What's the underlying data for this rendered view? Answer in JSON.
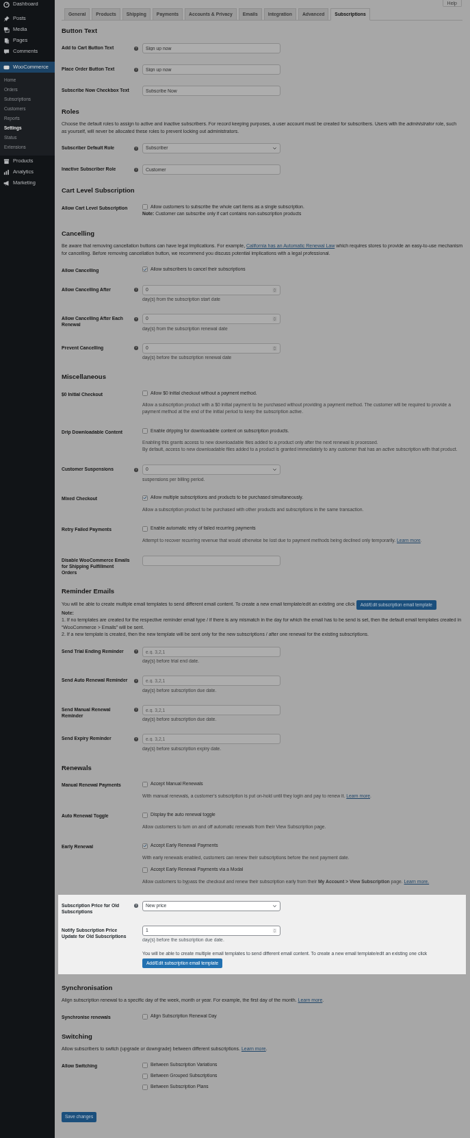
{
  "sidebar": {
    "items": [
      {
        "label": "Dashboard",
        "selected": false
      },
      {
        "label": "Posts",
        "selected": false
      },
      {
        "label": "Media",
        "selected": false
      },
      {
        "label": "Pages",
        "selected": false
      },
      {
        "label": "Comments",
        "selected": false
      },
      {
        "label": "WooCommerce",
        "selected": true,
        "children": [
          {
            "label": "Home",
            "selected": false
          },
          {
            "label": "Orders",
            "selected": false
          },
          {
            "label": "Subscriptions",
            "selected": false
          },
          {
            "label": "Customers",
            "selected": false
          },
          {
            "label": "Reports",
            "selected": false
          },
          {
            "label": "Settings",
            "selected": true
          },
          {
            "label": "Status",
            "selected": false
          },
          {
            "label": "Extensions",
            "selected": false
          }
        ]
      },
      {
        "label": "Products",
        "selected": false
      },
      {
        "label": "Analytics",
        "selected": false
      },
      {
        "label": "Marketing",
        "selected": false
      }
    ]
  },
  "help_button": "Help",
  "tabs": [
    {
      "label": "General",
      "selected": false
    },
    {
      "label": "Products",
      "selected": false
    },
    {
      "label": "Shipping",
      "selected": false
    },
    {
      "label": "Payments",
      "selected": false
    },
    {
      "label": "Accounts & Privacy",
      "selected": false
    },
    {
      "label": "Emails",
      "selected": false
    },
    {
      "label": "Integration",
      "selected": false
    },
    {
      "label": "Advanced",
      "selected": false
    },
    {
      "label": "Subscriptions",
      "selected": true
    }
  ],
  "sections": [
    {
      "title": "Button Text",
      "rows": [
        {
          "label": "Add to Cart Button Text",
          "help": true,
          "controls": [
            {
              "kind": "text",
              "value": "Sign up now"
            }
          ]
        },
        {
          "label": "Place Order Button Text",
          "help": true,
          "controls": [
            {
              "kind": "text",
              "value": "Sign up now"
            }
          ]
        },
        {
          "label": "Subscribe Now Checkbox Text",
          "help": false,
          "controls": [
            {
              "kind": "text",
              "value": "Subscribe Now"
            }
          ]
        }
      ]
    },
    {
      "title": "Roles",
      "description": [
        {
          "parts": [
            {
              "kind": "text",
              "text": "Choose the default roles to assign to active and inactive subscribers. For record keeping purposes, a user account must be created for subscribers. Users with the *administrator* role, such as yourself, will never be allocated these roles to prevent locking out administrators."
            }
          ]
        }
      ],
      "rows": [
        {
          "label": "Subscriber Default Role",
          "help": true,
          "controls": [
            {
              "kind": "select",
              "value": "Subscriber"
            }
          ]
        },
        {
          "label": "Inactive Subscriber Role",
          "help": true,
          "controls": [
            {
              "kind": "text",
              "value": "Customer"
            }
          ]
        }
      ]
    },
    {
      "title": "Cart Level Subscription",
      "rows": [
        {
          "label": "Allow Cart Level Subscription",
          "help": false,
          "controls": [
            {
              "kind": "checkbox",
              "label": "Allow customers to subscribe the whole cart items as a single subscription.",
              "checked": false
            },
            {
              "kind": "note",
              "parts": [
                {
                  "kind": "text",
                  "text": "**Note:** Customer can subscribe only if cart contains non-subscription products"
                }
              ]
            }
          ]
        }
      ]
    },
    {
      "title": "Cancelling",
      "description": [
        {
          "parts": [
            {
              "kind": "text",
              "text": "Be aware that removing cancellation buttons can have legal implications. For example, "
            },
            {
              "kind": "link",
              "text": "California has an Automatic Renewal Law"
            },
            {
              "kind": "text",
              "text": " which requires stores to provide an easy-to-use mechanism for cancelling. Before removing cancellation button, we recommend you discuss potential implications with a legal professional."
            }
          ]
        }
      ],
      "rows": [
        {
          "label": "Allow Cancelling",
          "help": false,
          "controls": [
            {
              "kind": "checkbox",
              "label": "Allow subscribers to cancel their subscriptions",
              "checked": true
            }
          ]
        },
        {
          "label": "Allow Cancelling After",
          "help": true,
          "controls": [
            {
              "kind": "number",
              "value": "0"
            },
            {
              "kind": "description",
              "parts": [
                {
                  "kind": "text",
                  "text": "day(s) from the subscription start date"
                }
              ]
            }
          ]
        },
        {
          "label": "Allow Cancelling After Each Renewal",
          "help": true,
          "controls": [
            {
              "kind": "number",
              "value": "0"
            },
            {
              "kind": "description",
              "parts": [
                {
                  "kind": "text",
                  "text": "day(s) from the subscription renewal date"
                }
              ]
            }
          ]
        },
        {
          "label": "Prevent Cancelling",
          "help": true,
          "controls": [
            {
              "kind": "number",
              "value": "0"
            },
            {
              "kind": "description",
              "parts": [
                {
                  "kind": "text",
                  "text": "day(s) before the subscription renewal date"
                }
              ]
            }
          ]
        }
      ]
    },
    {
      "title": "Miscellaneous",
      "rows": [
        {
          "label": "$0 Initial Checkout",
          "help": false,
          "controls": [
            {
              "kind": "checkbox",
              "label": "Allow $0 initial checkout without a payment method.",
              "checked": false
            },
            {
              "kind": "description",
              "parts": [
                {
                  "kind": "text",
                  "text": "Allow a subscription product with a $0 initial payment to be purchased without providing a payment method. The customer will be required to provide a payment method at the end of the initial period to keep the subscription active."
                }
              ]
            }
          ]
        },
        {
          "label": "Drip Downloadable Content",
          "help": false,
          "controls": [
            {
              "kind": "checkbox",
              "label": "Enable dripping for downloadable content on subscription products.",
              "checked": false
            },
            {
              "kind": "description",
              "parts": [
                {
                  "kind": "text",
                  "text": "Enabling this grants access to new downloadable files added to a product only after the next renewal is processed."
                }
              ]
            },
            {
              "kind": "description",
              "parts": [
                {
                  "kind": "text",
                  "text": "By default, access to new downloadable files added to a product is granted immediately to any customer that has an active subscription with that product."
                }
              ]
            }
          ]
        },
        {
          "label": "Customer Suspensions",
          "help": true,
          "controls": [
            {
              "kind": "select",
              "value": "0"
            },
            {
              "kind": "description",
              "parts": [
                {
                  "kind": "text",
                  "text": "suspensions per billing period."
                }
              ]
            }
          ]
        },
        {
          "label": "Mixed Checkout",
          "help": false,
          "controls": [
            {
              "kind": "checkbox",
              "label": "Allow multiple subscriptions and products to be purchased simultaneously.",
              "checked": true
            },
            {
              "kind": "description",
              "parts": [
                {
                  "kind": "text",
                  "text": "Allow a subscription product to be purchased with other products and subscriptions in the same transaction."
                }
              ]
            }
          ]
        },
        {
          "label": "Retry Failed Payments",
          "help": false,
          "controls": [
            {
              "kind": "checkbox",
              "label": "Enable automatic retry of failed recurring payments",
              "checked": false
            },
            {
              "kind": "description",
              "parts": [
                {
                  "kind": "text",
                  "text": "Attempt to recover recurring revenue that would otherwise be lost due to payment methods being declined only temporarily. "
                },
                {
                  "kind": "link",
                  "text": "Learn more"
                },
                {
                  "kind": "text",
                  "text": "."
                }
              ]
            }
          ]
        },
        {
          "label": "Disable WooCommerce Emails for Shipping Fulfillment Orders",
          "help": false,
          "controls": [
            {
              "kind": "text"
            }
          ]
        }
      ]
    },
    {
      "title": "Reminder Emails",
      "description": [
        {
          "parts": [
            {
              "kind": "text",
              "text": "You will be able to create multiple email templates to send different email content. To create a new email template/edit an existing one click"
            }
          ],
          "button": "Add/Edit subscription email template"
        },
        {
          "parts": [
            {
              "kind": "strong",
              "text": "Note:"
            }
          ]
        },
        {
          "parts": [
            {
              "kind": "text",
              "text": "1. If no templates are created for the respective reminder email type / if there is any mismatch in the day for which the email has to be send is set, then the default email templates created in “WooCommerce > Emails” will be sent."
            }
          ]
        },
        {
          "parts": [
            {
              "kind": "text",
              "text": "2. If a new template is created, then the new template will be sent only for the new subscriptions / after one renewal for the existing subscriptions."
            }
          ]
        }
      ],
      "rows": [
        {
          "label": "Send Trial Ending Reminder",
          "help": true,
          "controls": [
            {
              "kind": "text",
              "placeholder": "e.g. 3,2,1"
            },
            {
              "kind": "description",
              "parts": [
                {
                  "kind": "text",
                  "text": "day(s) before trial end date."
                }
              ]
            }
          ]
        },
        {
          "label": "Send Auto Renewal Reminder",
          "help": true,
          "controls": [
            {
              "kind": "text",
              "placeholder": "e.g. 3,2,1"
            },
            {
              "kind": "description",
              "parts": [
                {
                  "kind": "text",
                  "text": "day(s) before subscription due date."
                }
              ]
            }
          ]
        },
        {
          "label": "Send Manual Renewal Reminder",
          "help": true,
          "controls": [
            {
              "kind": "text",
              "placeholder": "e.g. 3,2,1"
            },
            {
              "kind": "description",
              "parts": [
                {
                  "kind": "text",
                  "text": "day(s) before subscription due date."
                }
              ]
            }
          ]
        },
        {
          "label": "Send Expiry Reminder",
          "help": true,
          "controls": [
            {
              "kind": "text",
              "placeholder": "e.g. 3,2,1"
            },
            {
              "kind": "description",
              "parts": [
                {
                  "kind": "text",
                  "text": "day(s) before subscription expiry date."
                }
              ]
            }
          ]
        }
      ]
    },
    {
      "title": "Renewals",
      "rows": [
        {
          "label": "Manual Renewal Payments",
          "help": false,
          "controls": [
            {
              "kind": "checkbox",
              "label": "Accept Manual Renewals",
              "checked": false
            },
            {
              "kind": "description",
              "parts": [
                {
                  "kind": "text",
                  "text": "With manual renewals, a customer's subscription is put on-hold until they login and pay to renew it. "
                },
                {
                  "kind": "link",
                  "text": "Learn more"
                },
                {
                  "kind": "text",
                  "text": "."
                }
              ]
            }
          ]
        },
        {
          "label": "Auto Renewal Toggle",
          "help": false,
          "controls": [
            {
              "kind": "checkbox",
              "label": "Display the auto renewal toggle",
              "checked": false
            },
            {
              "kind": "description",
              "parts": [
                {
                  "kind": "text",
                  "text": "Allow customers to turn on and off automatic renewals from their View Subscription page."
                }
              ]
            }
          ]
        },
        {
          "label": "Early Renewal",
          "help": false,
          "controls": [
            {
              "kind": "checkbox",
              "label": "Accept Early Renewal Payments",
              "checked": true
            },
            {
              "kind": "description",
              "parts": [
                {
                  "kind": "text",
                  "text": "With early renewals enabled, customers can renew their subscriptions before the next payment date."
                }
              ]
            },
            {
              "kind": "checkbox",
              "label": "Accept Early Renewal Payments via a Modal",
              "checked": false
            },
            {
              "kind": "description",
              "parts": [
                {
                  "kind": "text",
                  "text": "Allow customers to bypass the checkout and renew their subscription early from their **My Account > View Subscription** page. "
                },
                {
                  "kind": "link",
                  "text": "Learn more."
                }
              ]
            }
          ]
        },
        {
          "label": "Subscription Price for Old Subscriptions",
          "help": true,
          "highlighted": true,
          "controls": [
            {
              "kind": "select",
              "value": "New price"
            }
          ]
        },
        {
          "label": "Notify Subscription Price Update for Old Subscriptions",
          "help": false,
          "highlighted": true,
          "controls": [
            {
              "kind": "number",
              "value": "1"
            },
            {
              "kind": "description",
              "parts": [
                {
                  "kind": "text",
                  "text": "day(s) before the subscription due date."
                }
              ]
            },
            {
              "kind": "paragraph",
              "parts": [
                {
                  "kind": "text",
                  "text": "You will be able to create multiple email templates to send different email content. To create a new email template/edit an existing one click"
                }
              ]
            },
            {
              "kind": "button",
              "label": "Add/Edit subscription email template"
            }
          ]
        }
      ]
    },
    {
      "title": "Synchronisation",
      "description": [
        {
          "parts": [
            {
              "kind": "text",
              "text": "Align subscription renewal to a specific day of the week, month or year. For example, the first day of the month. "
            },
            {
              "kind": "link",
              "text": "Learn more"
            },
            {
              "kind": "text",
              "text": "."
            }
          ]
        }
      ],
      "rows": [
        {
          "label": "Synchronise renewals",
          "help": false,
          "controls": [
            {
              "kind": "checkbox",
              "label": "Align Subscription Renewal Day",
              "checked": false
            }
          ]
        }
      ]
    },
    {
      "title": "Switching",
      "description": [
        {
          "parts": [
            {
              "kind": "text",
              "text": "Allow subscribers to switch (upgrade or downgrade) between different subscriptions. "
            },
            {
              "kind": "link",
              "text": "Learn more"
            },
            {
              "kind": "text",
              "text": "."
            }
          ]
        }
      ],
      "rows": [
        {
          "label": "Allow Switching",
          "help": false,
          "controls": [
            {
              "kind": "checkbox",
              "label": "Between Subscription Variations",
              "checked": false
            },
            {
              "kind": "checkbox",
              "label": "Between Grouped Subscriptions",
              "checked": false
            },
            {
              "kind": "checkbox",
              "label": "Between Subscription Plans",
              "checked": false
            }
          ]
        }
      ]
    }
  ],
  "save_button": "Save changes"
}
